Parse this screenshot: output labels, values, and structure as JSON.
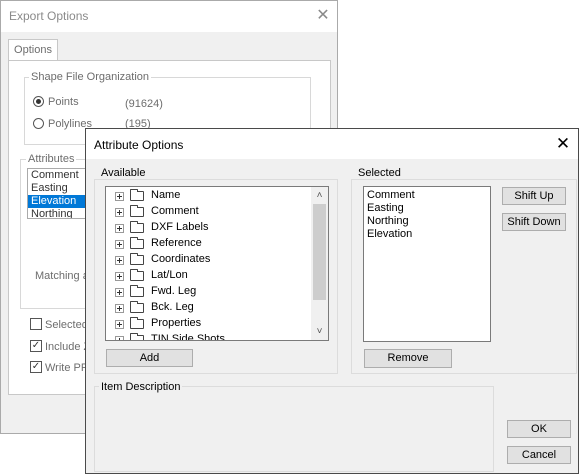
{
  "export_window": {
    "title": "Export Options",
    "tab": "Options",
    "shape_group_label": "Shape File Organization",
    "radios": [
      {
        "label": "Points",
        "count": "(91624)",
        "checked": true
      },
      {
        "label": "Polylines",
        "count": "(195)",
        "checked": false
      }
    ],
    "attributes_label": "Attributes",
    "attribute_items": [
      "Comment",
      "Easting",
      "Elevation",
      "Northing"
    ],
    "selected_attribute": "Elevation",
    "matching_partial": "Matching a",
    "checkboxes": [
      {
        "label": "Selected",
        "checked": false
      },
      {
        "label": "Include Z",
        "checked": true
      },
      {
        "label": "Write PR",
        "checked": true
      }
    ]
  },
  "attribute_dialog": {
    "title": "Attribute Options",
    "available_label": "Available",
    "available_items": [
      "Name",
      "Comment",
      "DXF Labels",
      "Reference",
      "Coordinates",
      "Lat/Lon",
      "Fwd. Leg",
      "Bck. Leg",
      "Properties",
      "TIN Side Shots"
    ],
    "add_button": "Add",
    "selected_label": "Selected",
    "selected_items": [
      "Comment",
      "Easting",
      "Northing",
      "Elevation"
    ],
    "remove_button": "Remove",
    "shift_up_button": "Shift Up",
    "shift_down_button": "Shift Down",
    "item_description_label": "Item Description",
    "ok_button": "OK",
    "cancel_button": "Cancel"
  }
}
